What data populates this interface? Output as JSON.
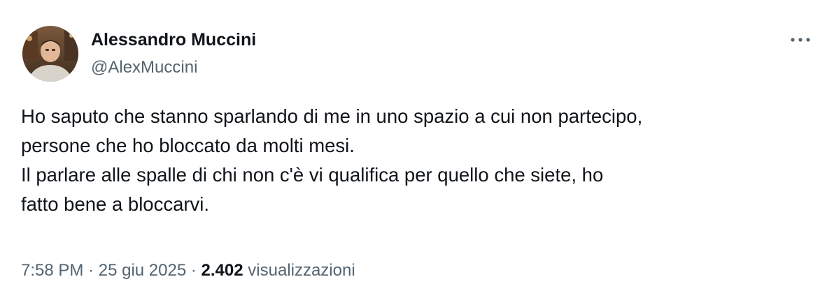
{
  "author": {
    "display_name": "Alessandro Muccini",
    "handle": "@AlexMuccini"
  },
  "menu": {
    "icon": "more-horizontal-icon"
  },
  "tweet": {
    "lines": [
      "Ho saputo che stanno sparlando di me in uno spazio a cui non partecipo,",
      "persone che ho bloccato da molti mesi.",
      "Il parlare alle spalle di chi non c'è vi qualifica per quello che siete, ho",
      "fatto bene a bloccarvi."
    ]
  },
  "meta": {
    "time": "7:58 PM",
    "separator": "·",
    "date": "25 giu 2025",
    "views_count": "2.402",
    "views_label": "visualizzazioni"
  },
  "colors": {
    "text_primary": "#0f1419",
    "text_secondary": "#536471",
    "background": "#ffffff"
  }
}
